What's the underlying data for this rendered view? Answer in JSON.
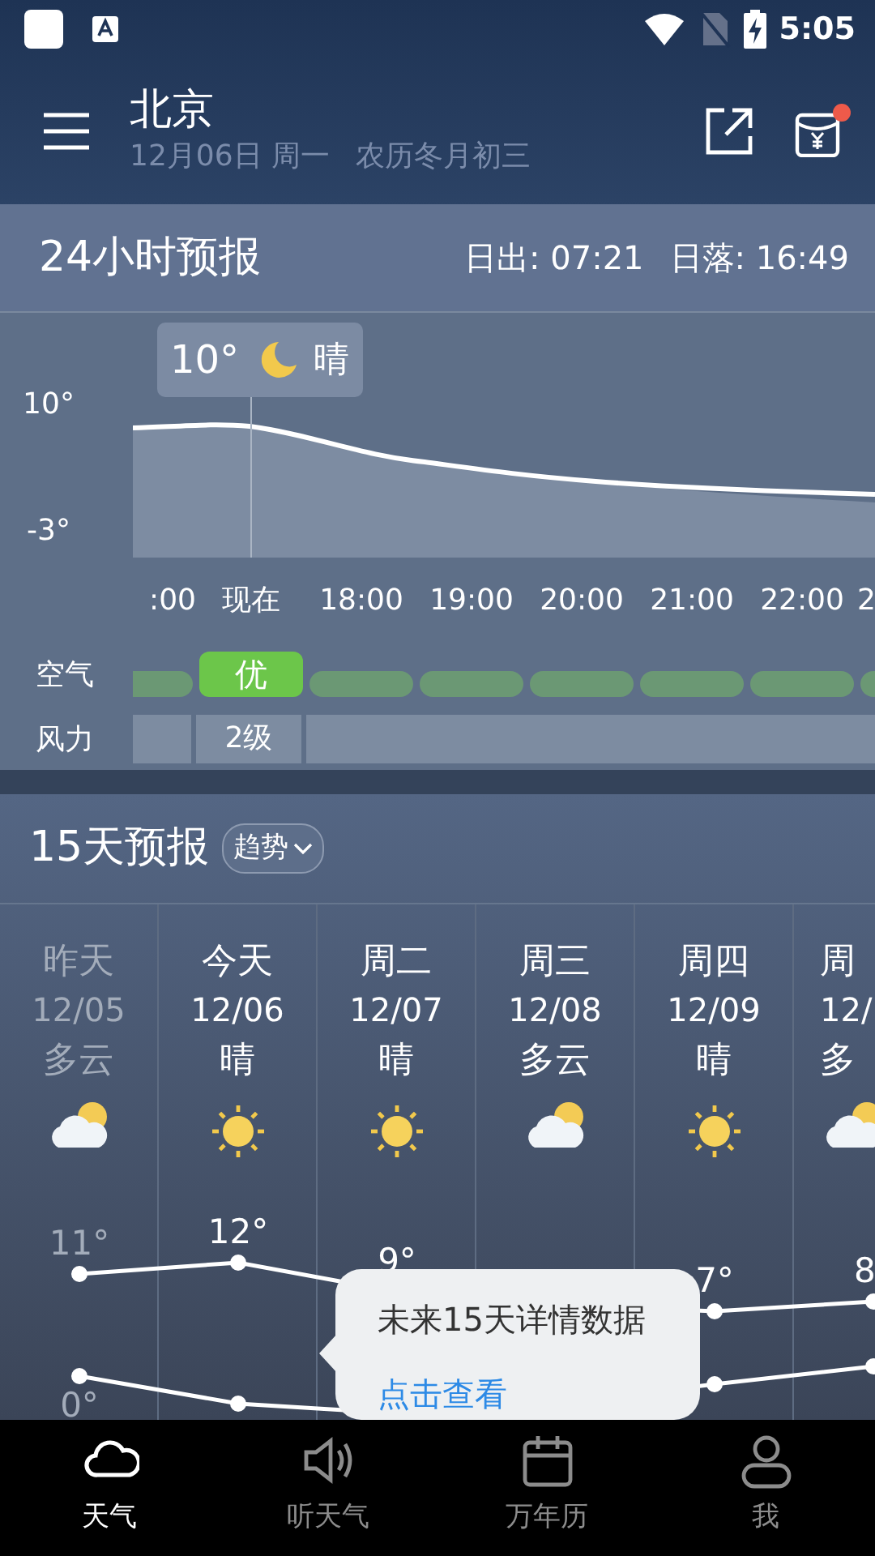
{
  "status_bar": {
    "time": "5:05"
  },
  "header": {
    "city": "北京",
    "date": "12月06日 周一",
    "lunar": "农历冬月初三",
    "badge_dot": true
  },
  "hourly": {
    "title": "24小时预报",
    "sunrise": "日出: 07:21",
    "sunset": "日落: 16:49",
    "y_labels": [
      "10°",
      "-3°"
    ],
    "tooltip": {
      "temp": "10°",
      "weather": "晴"
    },
    "air_label": "空气",
    "wind_label": "风力",
    "hours": [
      {
        "time": ":00",
        "selected": false
      },
      {
        "time": "现在",
        "selected": true,
        "air": "优",
        "wind": "2级"
      },
      {
        "time": "18:00",
        "selected": false
      },
      {
        "time": "19:00",
        "selected": false
      },
      {
        "time": "20:00",
        "selected": false
      },
      {
        "time": "21:00",
        "selected": false
      },
      {
        "time": "22:00",
        "selected": false
      },
      {
        "time": "2",
        "selected": false
      }
    ]
  },
  "daily": {
    "title": "15天预报",
    "trend_button": "趋势",
    "days": [
      {
        "day": "昨天",
        "date": "12/05",
        "weather": "多云",
        "kind": "cloudy",
        "past": true,
        "high": "11°",
        "low": "0°"
      },
      {
        "day": "今天",
        "date": "12/06",
        "weather": "晴",
        "kind": "sunny",
        "past": false,
        "high": "12°"
      },
      {
        "day": "周二",
        "date": "12/07",
        "weather": "晴",
        "kind": "sunny",
        "past": false,
        "high": "9°"
      },
      {
        "day": "周三",
        "date": "12/08",
        "weather": "多云",
        "kind": "cloudy",
        "past": false
      },
      {
        "day": "周四",
        "date": "12/09",
        "weather": "晴",
        "kind": "sunny",
        "past": false,
        "high": "7°"
      },
      {
        "day": "周",
        "date": "12/",
        "weather": "多",
        "kind": "cloudy",
        "past": false,
        "high": "8"
      }
    ],
    "popup": {
      "text": "未来15天详情数据",
      "link": "点击查看"
    }
  },
  "bottom_nav": [
    {
      "label": "天气",
      "kind": "weather",
      "selected": true
    },
    {
      "label": "听天气",
      "kind": "listen",
      "selected": false
    },
    {
      "label": "万年历",
      "kind": "calendar",
      "selected": false
    },
    {
      "label": "我",
      "kind": "profile",
      "selected": false
    }
  ]
}
